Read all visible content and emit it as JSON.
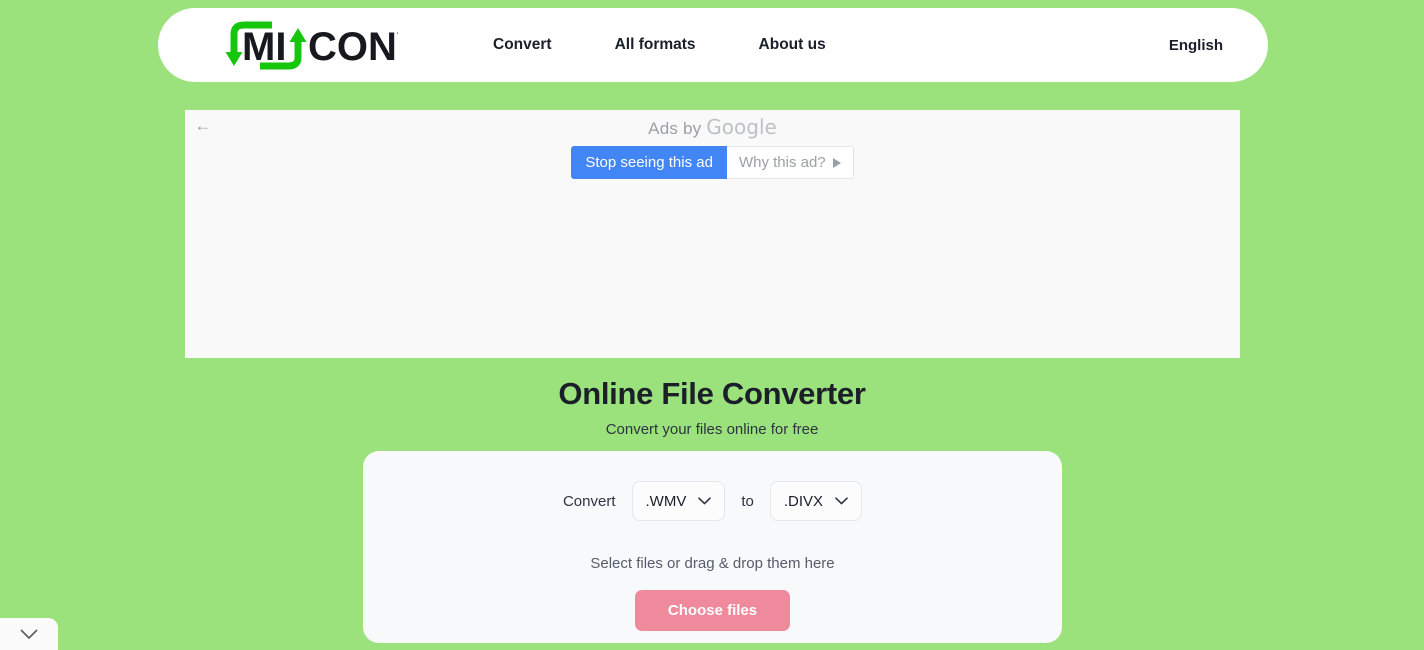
{
  "header": {
    "logo": {
      "text_primary": "MI",
      "text_secondary": "CONV",
      "icon": "circular-arrows-icon",
      "accent_color": "#16c60c"
    },
    "nav": [
      {
        "label": "Convert",
        "name": "nav-convert"
      },
      {
        "label": "All formats",
        "name": "nav-all-formats"
      },
      {
        "label": "About us",
        "name": "nav-about-us"
      }
    ],
    "language": "English"
  },
  "ad": {
    "back_icon": "arrow-left-icon",
    "ads_by_prefix": "Ads by ",
    "ads_by_brand": "Google",
    "stop_button": "Stop seeing this ad",
    "why_button": "Why this ad?",
    "why_icon": "play-triangle-icon",
    "stop_button_color": "#4285f4"
  },
  "hero": {
    "title": "Online File Converter",
    "subtitle": "Convert your files online for free"
  },
  "converter": {
    "convert_label": "Convert",
    "to_label": "to",
    "source_format": ".WMV",
    "target_format": ".DIVX",
    "dropdown_icon": "chevron-down-icon",
    "drop_zone_text": "Select files or drag & drop them here",
    "choose_files_button": "Choose files",
    "button_color": "#ee8a9c"
  },
  "bottom_tab": {
    "icon": "chevron-down-icon"
  },
  "colors": {
    "page_background": "#9ce27c",
    "header_background": "#ffffff",
    "ad_background": "#f9f9f9",
    "card_background": "#f8f9fb"
  }
}
